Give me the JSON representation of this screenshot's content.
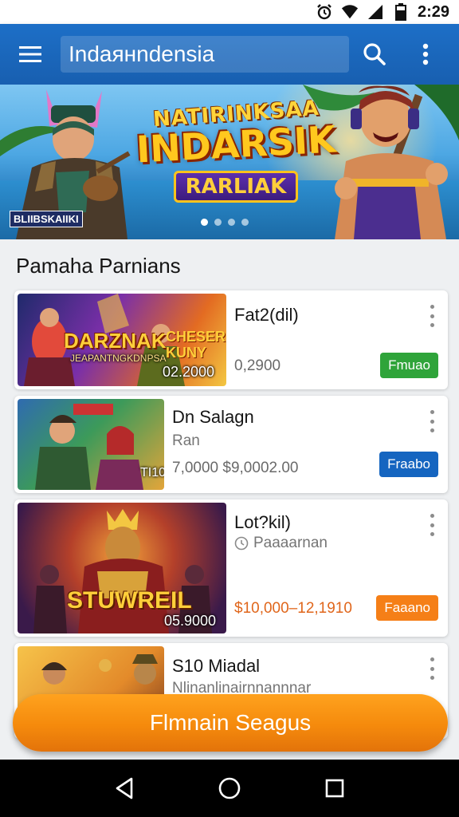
{
  "status_bar": {
    "time": "2:29"
  },
  "app_bar": {
    "search_text": "Indaянndensia"
  },
  "banner": {
    "title_top": "NATIRINKSAA",
    "title_main": "INDARSIK",
    "title_tag": "RARLIAK",
    "badge": "BLIIBSKAIIKI",
    "page_count": 4,
    "active_page": 1
  },
  "section": {
    "title": "Pamaha Parnians"
  },
  "cards": [
    {
      "title": "Fat2(dil)",
      "thumb_title": "DARZNAK",
      "thumb_title2": "CHESER KUNY",
      "thumb_sub": "JEAPANTNGKDNPSA",
      "thumb_price": "02.2000",
      "price": "0,2900",
      "button": "Fmuao",
      "button_color": "#2fa43a"
    },
    {
      "title": "Dn Salagn",
      "subtitle": "Ran",
      "thumb_tag": "TI10",
      "price": "7,0000 $9,0002.00",
      "button": "Fraabo",
      "button_color": "#1565c0"
    },
    {
      "title": "Lot?kil)",
      "subtitle": "Paaaarnan",
      "thumb_title": "STUWREIL",
      "thumb_price": "05.9000",
      "price": "$10,000–12,1910",
      "button": "Faaano",
      "button_color": "#f57f17"
    },
    {
      "title": "S10 Miadal",
      "subtitle": "Nlinanlinairnnannnar"
    }
  ],
  "cta": {
    "label": "Flmnain Seagus"
  }
}
